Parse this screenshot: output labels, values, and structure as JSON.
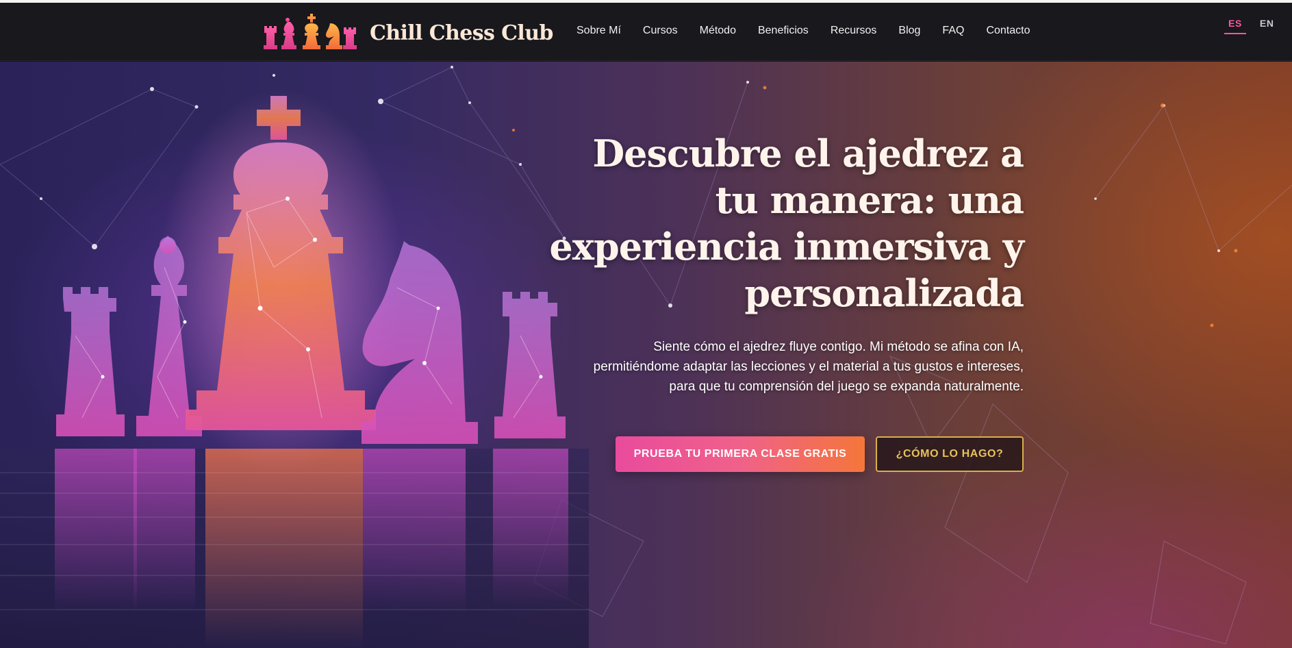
{
  "header": {
    "brand_name": "Chill Chess Club",
    "nav": [
      {
        "label": "Sobre Mí"
      },
      {
        "label": "Cursos"
      },
      {
        "label": "Método"
      },
      {
        "label": "Beneficios"
      },
      {
        "label": "Recursos"
      },
      {
        "label": "Blog"
      },
      {
        "label": "FAQ"
      },
      {
        "label": "Contacto"
      }
    ],
    "languages": [
      {
        "code": "ES",
        "active": true
      },
      {
        "code": "EN",
        "active": false
      }
    ]
  },
  "hero": {
    "title": "Descubre el ajedrez a tu manera: una experiencia inmersiva y personalizada",
    "subtitle": "Siente cómo el ajedrez fluye contigo. Mi método se afina con IA, permitiéndome adaptar las lecciones y el material a tus gustos e intereses, para que tu comprensión del juego se expanda naturalmente.",
    "primary_cta": "PRUEBA TU PRIMERA CLASE GRATIS",
    "secondary_cta": "¿CÓMO LO HAGO?",
    "background_icon": "constellation-chess-pieces-image"
  },
  "colors": {
    "accent_pink": "#ff56a3",
    "accent_orange": "#f5763a",
    "accent_gold": "#d8b04c",
    "header_bg": "#19181d"
  }
}
